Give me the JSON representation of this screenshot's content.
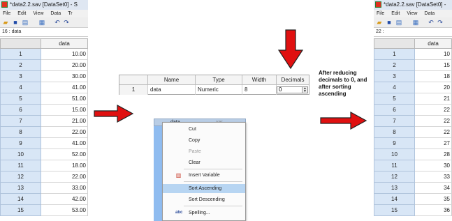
{
  "left_window": {
    "title": "*data2.2.sav [DataSet0] - S",
    "menu": [
      "File",
      "Edit",
      "View",
      "Data",
      "Tr"
    ],
    "cell_ref": "16 : data",
    "column_header": "data",
    "rows": [
      {
        "num": "1",
        "value": "10.00"
      },
      {
        "num": "2",
        "value": "20.00"
      },
      {
        "num": "3",
        "value": "30.00"
      },
      {
        "num": "4",
        "value": "41.00"
      },
      {
        "num": "5",
        "value": "51.00"
      },
      {
        "num": "6",
        "value": "15.00"
      },
      {
        "num": "7",
        "value": "21.00"
      },
      {
        "num": "8",
        "value": "22.00"
      },
      {
        "num": "9",
        "value": "41.00"
      },
      {
        "num": "10",
        "value": "52.00"
      },
      {
        "num": "11",
        "value": "18.00"
      },
      {
        "num": "12",
        "value": "22.00"
      },
      {
        "num": "13",
        "value": "33.00"
      },
      {
        "num": "14",
        "value": "42.00"
      },
      {
        "num": "15",
        "value": "53.00"
      }
    ]
  },
  "variable_view": {
    "headers": [
      "Name",
      "Type",
      "Width",
      "Decimals"
    ],
    "row_num": "1",
    "name": "data",
    "type": "Numeric",
    "width": "8",
    "decimals": "0"
  },
  "note_text": "After reducing decimals to 0, and after sorting ascending",
  "context_menu": {
    "column_header": "data",
    "neighbor_header": "var",
    "items": [
      {
        "label": "Cut",
        "disabled": false
      },
      {
        "label": "Copy",
        "disabled": false
      },
      {
        "label": "Paste",
        "disabled": true
      },
      {
        "label": "Clear",
        "disabled": false
      },
      {
        "label": "Insert Variable",
        "disabled": false
      },
      {
        "label": "Sort Ascending",
        "disabled": false,
        "highlighted": true
      },
      {
        "label": "Sort Descending",
        "disabled": false
      },
      {
        "label": "Spelling...",
        "disabled": false
      }
    ]
  },
  "right_window": {
    "title": "*data2.2.sav [DataSet0] -",
    "menu": [
      "File",
      "Edit",
      "View",
      "Data"
    ],
    "cell_ref": "22 :",
    "column_header": "data",
    "rows": [
      {
        "num": "1",
        "value": "10"
      },
      {
        "num": "2",
        "value": "15"
      },
      {
        "num": "3",
        "value": "18"
      },
      {
        "num": "4",
        "value": "20"
      },
      {
        "num": "5",
        "value": "21"
      },
      {
        "num": "6",
        "value": "22"
      },
      {
        "num": "7",
        "value": "22"
      },
      {
        "num": "8",
        "value": "22"
      },
      {
        "num": "9",
        "value": "27"
      },
      {
        "num": "10",
        "value": "28"
      },
      {
        "num": "11",
        "value": "30"
      },
      {
        "num": "12",
        "value": "33"
      },
      {
        "num": "13",
        "value": "34"
      },
      {
        "num": "14",
        "value": "35"
      },
      {
        "num": "15",
        "value": "36"
      }
    ]
  },
  "colors": {
    "arrow": "#e01010",
    "row_header": "#d8e6f6",
    "highlight": "#b7d5f2",
    "selected_column": "#8fbcf0"
  },
  "icons": [
    "spss-app-icon",
    "open-folder-icon",
    "save-icon",
    "print-icon",
    "data-editor-icon",
    "undo-icon",
    "redo-icon",
    "down-arrow-icon",
    "right-arrow-icon",
    "insert-variable-icon",
    "spelling-icon",
    "spin-up-icon",
    "spin-down-icon"
  ]
}
